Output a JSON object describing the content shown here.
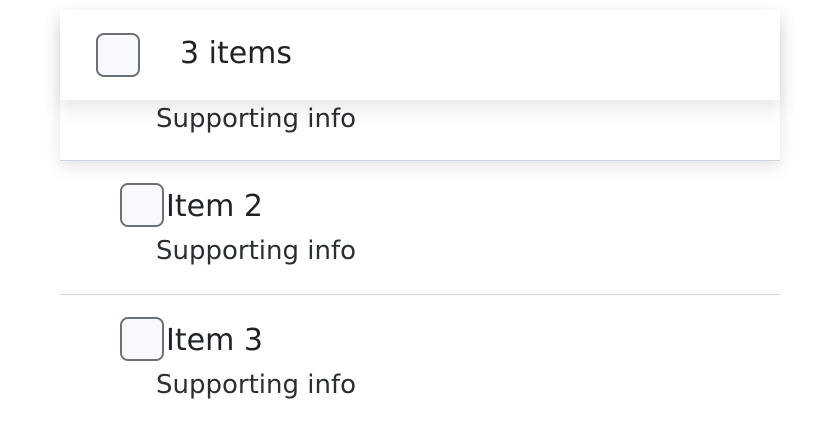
{
  "selection_header": {
    "count_label": "3 items"
  },
  "items": [
    {
      "title": "",
      "supporting": "Supporting info"
    },
    {
      "title": "Item 2",
      "supporting": "Supporting info"
    },
    {
      "title": "Item 3",
      "supporting": "Supporting info"
    }
  ]
}
